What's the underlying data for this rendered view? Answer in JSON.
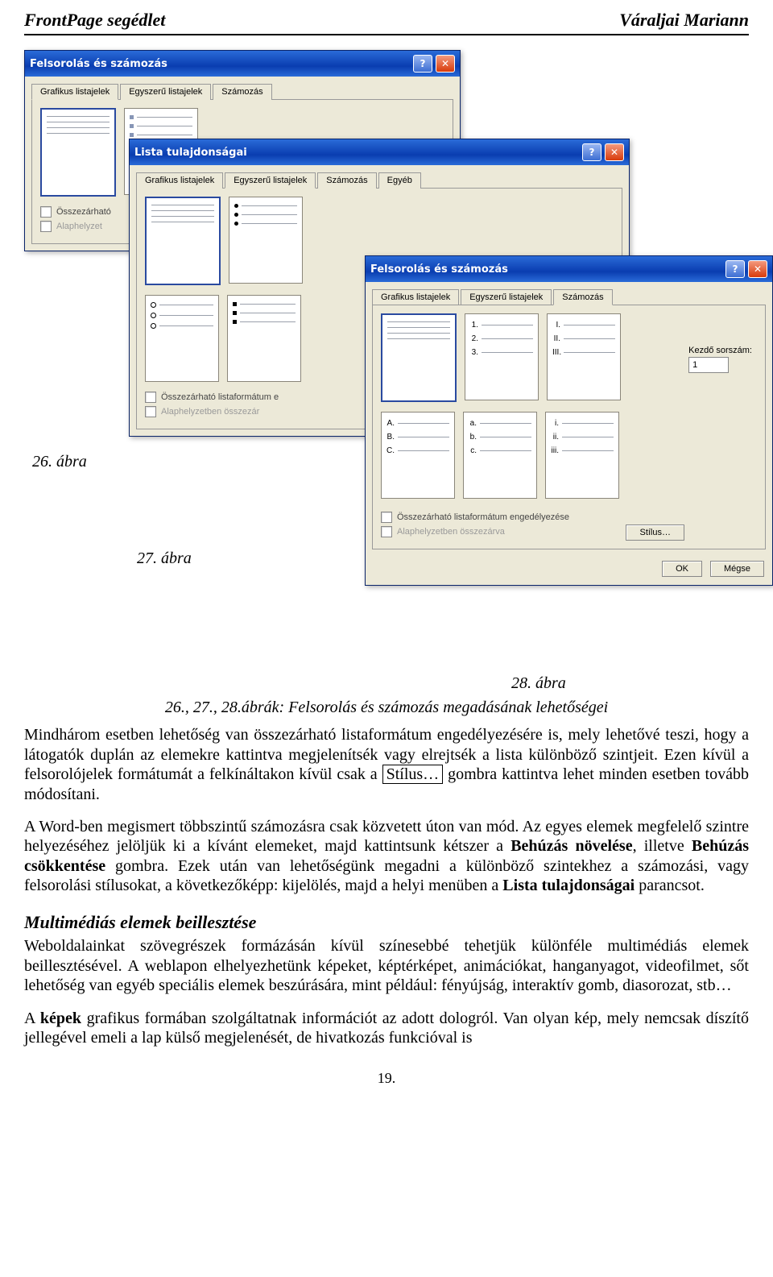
{
  "header": {
    "left": "FrontPage segédlet",
    "right": "Váraljai Mariann"
  },
  "win1": {
    "title": "Felsorolás és számozás",
    "tabs": [
      "Grafikus listajelek",
      "Egyszerű listajelek",
      "Számozás"
    ],
    "selected": 0,
    "chk1": "Összezárható",
    "chk2": "Alaphelyzet"
  },
  "win2": {
    "title": "Lista tulajdonságai",
    "tabs": [
      "Grafikus listajelek",
      "Egyszerű listajelek",
      "Számozás",
      "Egyéb"
    ],
    "selected": 1,
    "chk1": "Összezárható listaformátum e",
    "chk2": "Alaphelyzetben összezár"
  },
  "win3": {
    "title": "Felsorolás és számozás",
    "tabs": [
      "Grafikus listajelek",
      "Egyszerű listajelek",
      "Számozás"
    ],
    "selected": 2,
    "kezdo_label": "Kezdő sorszám:",
    "kezdo_val": "1",
    "chk1": "Összezárható listaformátum engedélyezése",
    "chk2": "Alaphelyzetben összezárva",
    "stilus": "Stílus…",
    "ok": "OK",
    "megse": "Mégse",
    "num_arabic": [
      "1.",
      "2.",
      "3."
    ],
    "num_roman": [
      "I.",
      "II.",
      "III."
    ],
    "num_ABC": [
      "A.",
      "B.",
      "C."
    ],
    "num_abc": [
      "a.",
      "b.",
      "c."
    ],
    "num_i": [
      "i.",
      "ii.",
      "iii."
    ]
  },
  "captions": {
    "c26": "26. ábra",
    "c27": "27. ábra",
    "c28": "28. ábra"
  },
  "text": {
    "figline": "26., 27., 28.ábrák: Felsorolás és számozás megadásának lehetőségei",
    "p1a": "Mindhárom esetben lehetőség van összezárható listaformátum engedélyezésére is, mely lehetővé teszi, hogy a látogatók duplán az elemekre kattintva megjelenítsék vagy elrejtsék a lista különböző szintjeit. Ezen kívül a felsorolójelek formátumát a felkínáltakon kívül csak a ",
    "stilus_boxed": "Stílus…",
    "p1b": " gombra kattintva lehet minden esetben tovább módosítani.",
    "p2a": "A Word-ben megismert többszintű számozásra csak közvetett úton van mód. Az egyes elemek megfelelő szintre helyezéséhez jelöljük ki a kívánt elemeket, majd kattintsunk kétszer a ",
    "behuz1": "Behúzás növelése",
    "p2b": ", illetve ",
    "behuz2": "Behúzás csökkentése",
    "p2c": " gombra. Ezek után van lehetőségünk megadni a különböző szintekhez a számozási, vagy felsorolási stílusokat, a következőképp: kijelölés, majd a helyi menüben a ",
    "listatul": "Lista tulajdonságai",
    "p2d": " parancsot.",
    "h2": "Multimédiás elemek beillesztése",
    "p3": "Weboldalainkat szövegrészek formázásán kívül színesebbé tehetjük különféle multimédiás elemek beillesztésével. A weblapon elhelyezhetünk képeket, képtérképet, animációkat, hanganyagot, videofilmet, sőt lehetőség van egyéb speciális elemek beszúrására, mint például: fényújság, interaktív gomb, diasorozat, stb…",
    "p4a": "A ",
    "kepek": "képek",
    "p4b": " grafikus formában szolgáltatnak információt az adott dologról. Van olyan kép, mely nemcsak díszítő jellegével emeli a lap külső megjelenését, de hivatkozás funkcióval is",
    "pgnum": "19."
  }
}
